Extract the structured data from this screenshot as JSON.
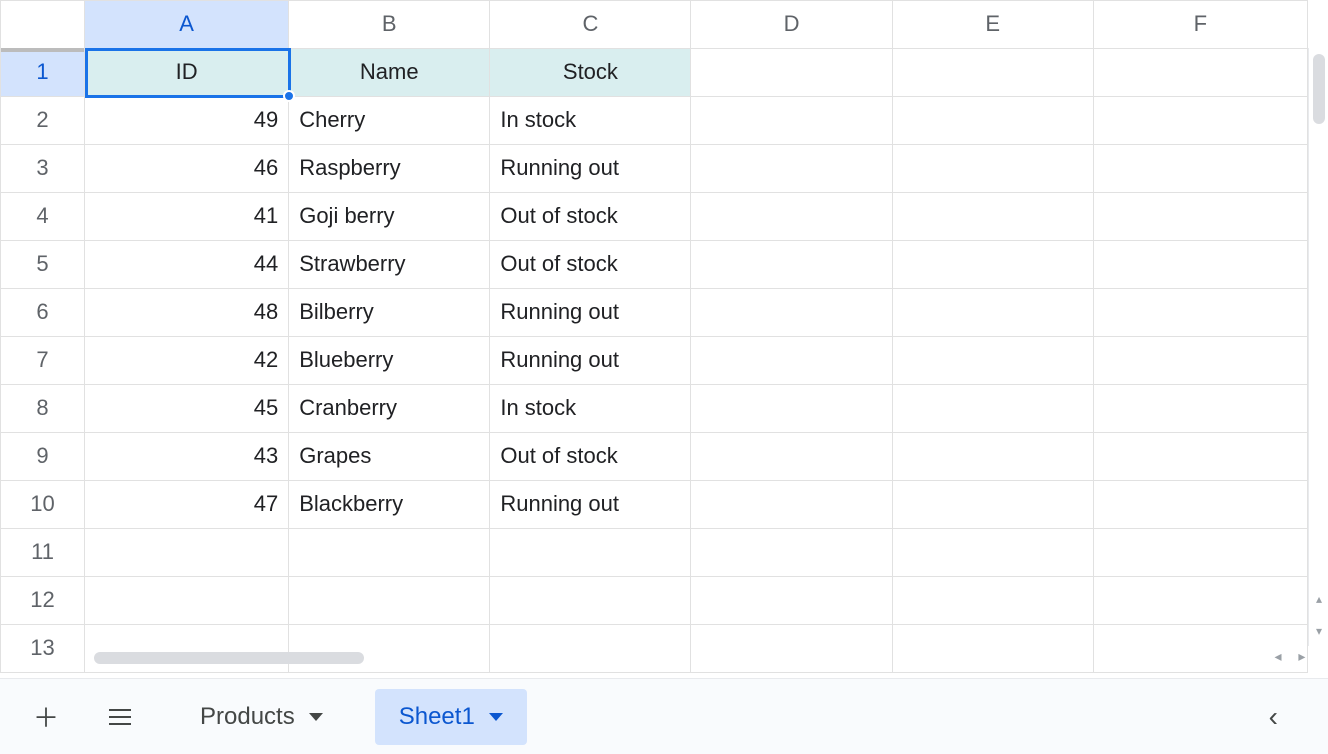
{
  "columns": [
    "A",
    "B",
    "C",
    "D",
    "E",
    "F"
  ],
  "row_numbers": [
    1,
    2,
    3,
    4,
    5,
    6,
    7,
    8,
    9,
    10,
    11,
    12,
    13
  ],
  "selected_cell": "A1",
  "headers": {
    "A": "ID",
    "B": "Name",
    "C": "Stock"
  },
  "rows": [
    {
      "id": "49",
      "name": "Cherry",
      "stock": "In stock"
    },
    {
      "id": "46",
      "name": "Raspberry",
      "stock": "Running out"
    },
    {
      "id": "41",
      "name": "Goji berry",
      "stock": "Out of stock"
    },
    {
      "id": "44",
      "name": "Strawberry",
      "stock": "Out of stock"
    },
    {
      "id": "48",
      "name": "Bilberry",
      "stock": "Running out"
    },
    {
      "id": "42",
      "name": "Blueberry",
      "stock": "Running out"
    },
    {
      "id": "45",
      "name": "Cranberry",
      "stock": "In stock"
    },
    {
      "id": "43",
      "name": "Grapes",
      "stock": "Out of stock"
    },
    {
      "id": "47",
      "name": "Blackberry",
      "stock": "Running out"
    }
  ],
  "tabs": {
    "inactive": "Products",
    "active": "Sheet1"
  }
}
